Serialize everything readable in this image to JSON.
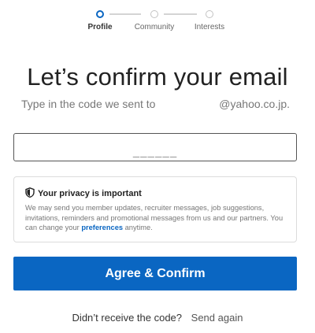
{
  "stepper": {
    "steps": [
      {
        "label": "Profile",
        "active": true
      },
      {
        "label": "Community",
        "active": false
      },
      {
        "label": "Interests",
        "active": false
      }
    ]
  },
  "title": "Let’s confirm your email",
  "subtitle": {
    "prefix": "Type in the code we sent to",
    "email_domain": "@yahoo.co.jp."
  },
  "code_input": {
    "value": "______"
  },
  "privacy": {
    "heading": "Your privacy is important",
    "body_before_link": "We may send you member updates, recruiter messages, job suggestions, invitations, reminders and promotional messages from us and our partners. You can change your ",
    "link_text": "preferences",
    "body_after_link": " anytime."
  },
  "primary_button": {
    "label": "Agree & Confirm"
  },
  "footer": {
    "question": "Didn’t receive the code?",
    "link": "Send again"
  },
  "colors": {
    "accent": "#0a66c2"
  }
}
